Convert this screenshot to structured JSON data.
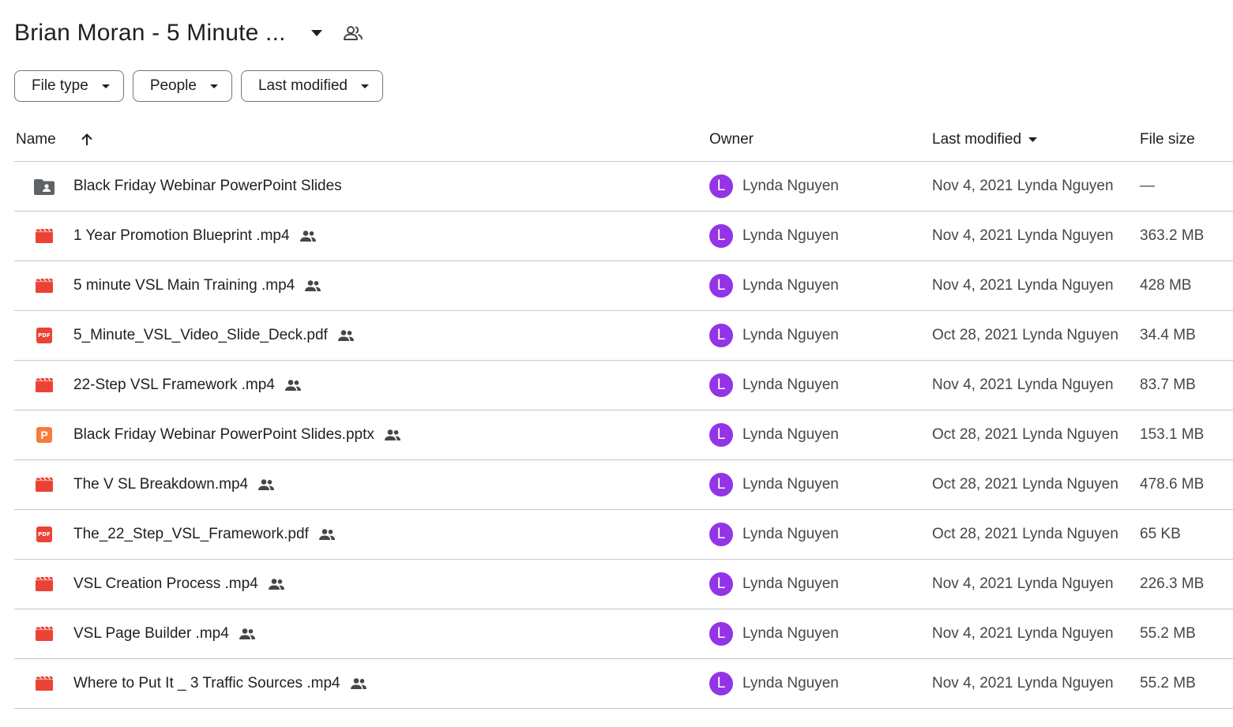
{
  "folder": {
    "title": "Brian Moran - 5 Minute ...",
    "title_caret_icon": "arrow-drop-down-icon",
    "share_icon": "people-outline-icon"
  },
  "filters": [
    {
      "label": "File type"
    },
    {
      "label": "People"
    },
    {
      "label": "Last modified"
    }
  ],
  "columns": {
    "name": "Name",
    "owner": "Owner",
    "last_modified": "Last modified",
    "file_size": "File size",
    "sort_icon": "arrow-upward-icon"
  },
  "colors": {
    "avatar": "#9334e6",
    "video_icon": "#ea4335",
    "pdf_icon": "#ea4335",
    "pptx_icon": "#f57c3c",
    "folder_icon": "#5f6368"
  },
  "files": [
    {
      "type": "shared-folder",
      "name": "Black Friday Webinar PowerPoint Slides",
      "shared": false,
      "avatar": "L",
      "owner": "Lynda Nguyen",
      "modified": "Nov 4, 2021 Lynda Nguyen",
      "size": "—"
    },
    {
      "type": "video",
      "name": "1 Year Promotion Blueprint .mp4",
      "shared": true,
      "avatar": "L",
      "owner": "Lynda Nguyen",
      "modified": "Nov 4, 2021 Lynda Nguyen",
      "size": "363.2 MB"
    },
    {
      "type": "video",
      "name": "5 minute VSL Main Training .mp4",
      "shared": true,
      "avatar": "L",
      "owner": "Lynda Nguyen",
      "modified": "Nov 4, 2021 Lynda Nguyen",
      "size": "428 MB"
    },
    {
      "type": "pdf",
      "name": "5_Minute_VSL_Video_Slide_Deck.pdf",
      "shared": true,
      "avatar": "L",
      "owner": "Lynda Nguyen",
      "modified": "Oct 28, 2021 Lynda Nguyen",
      "size": "34.4 MB"
    },
    {
      "type": "video",
      "name": "22-Step VSL Framework .mp4",
      "shared": true,
      "avatar": "L",
      "owner": "Lynda Nguyen",
      "modified": "Nov 4, 2021 Lynda Nguyen",
      "size": "83.7 MB"
    },
    {
      "type": "pptx",
      "name": "Black Friday Webinar PowerPoint Slides.pptx",
      "shared": true,
      "avatar": "L",
      "owner": "Lynda Nguyen",
      "modified": "Oct 28, 2021 Lynda Nguyen",
      "size": "153.1 MB"
    },
    {
      "type": "video",
      "name": "The V SL Breakdown.mp4",
      "shared": true,
      "avatar": "L",
      "owner": "Lynda Nguyen",
      "modified": "Oct 28, 2021 Lynda Nguyen",
      "size": "478.6 MB"
    },
    {
      "type": "pdf",
      "name": "The_22_Step_VSL_Framework.pdf",
      "shared": true,
      "avatar": "L",
      "owner": "Lynda Nguyen",
      "modified": "Oct 28, 2021 Lynda Nguyen",
      "size": "65 KB"
    },
    {
      "type": "video",
      "name": "VSL Creation Process .mp4",
      "shared": true,
      "avatar": "L",
      "owner": "Lynda Nguyen",
      "modified": "Nov 4, 2021 Lynda Nguyen",
      "size": "226.3 MB"
    },
    {
      "type": "video",
      "name": "VSL Page Builder .mp4",
      "shared": true,
      "avatar": "L",
      "owner": "Lynda Nguyen",
      "modified": "Nov 4, 2021 Lynda Nguyen",
      "size": "55.2 MB"
    },
    {
      "type": "video",
      "name": "Where to Put It _ 3 Traffic Sources .mp4",
      "shared": true,
      "avatar": "L",
      "owner": "Lynda Nguyen",
      "modified": "Nov 4, 2021 Lynda Nguyen",
      "size": "55.2 MB"
    }
  ]
}
